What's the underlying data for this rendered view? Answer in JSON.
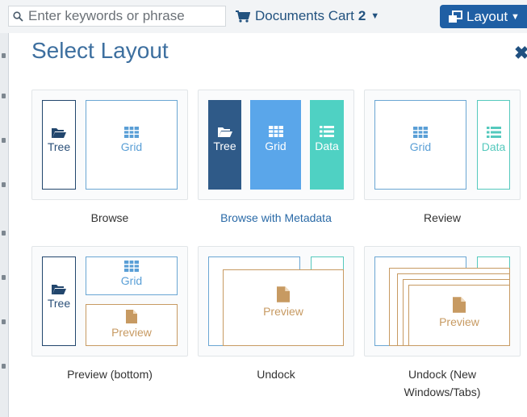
{
  "search": {
    "placeholder": "Enter keywords or phrase"
  },
  "cart": {
    "label": "Documents Cart",
    "count": "2"
  },
  "layout_button": {
    "label": "Layout"
  },
  "modal": {
    "title": "Select Layout",
    "layouts": [
      {
        "label": "Browse",
        "panes": [
          "Tree",
          "Grid"
        ]
      },
      {
        "label": "Browse with Metadata",
        "panes": [
          "Tree",
          "Grid",
          "Data"
        ]
      },
      {
        "label": "Review",
        "panes": [
          "Grid",
          "Data"
        ]
      },
      {
        "label": "Preview (bottom)",
        "panes": [
          "Tree",
          "Grid",
          "Preview"
        ]
      },
      {
        "label": "Undock",
        "panes": [
          "Preview"
        ]
      },
      {
        "label": "Undock (New",
        "label_line2": "Windows/Tabs)",
        "panes": [
          "Preview"
        ]
      }
    ]
  },
  "colors": {
    "accent": "#1f5fa4",
    "title": "#3d6f9f",
    "selected": "#2a6aa7",
    "blue_pane": "#5aa6ea",
    "dark_pane": "#2f5a88",
    "teal_pane": "#4fd1c3",
    "preview_brown": "#c79a62"
  },
  "icons": [
    "search-icon",
    "cart-icon",
    "layout-icon",
    "close-icon",
    "folder-icon",
    "grid-icon",
    "list-icon",
    "document-icon"
  ]
}
